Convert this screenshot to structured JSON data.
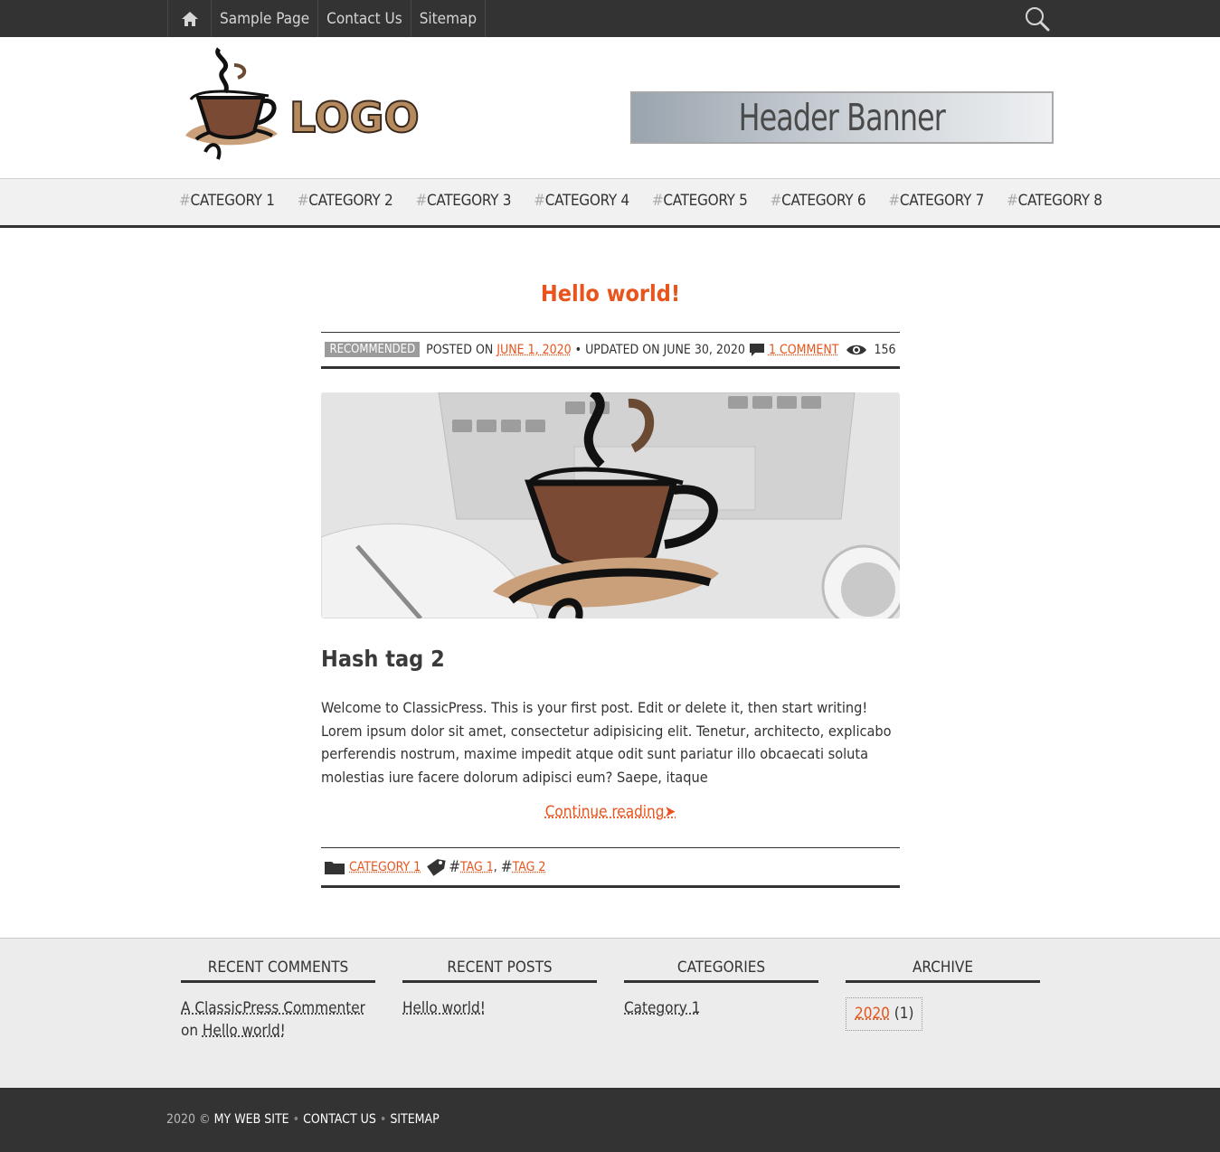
{
  "topbar": {
    "home_icon": "home-icon",
    "links": [
      "Sample Page",
      "Contact Us",
      "Sitemap"
    ],
    "search_icon": "search-icon"
  },
  "header": {
    "logo_text": "LOGO",
    "banner_text": "Header Banner"
  },
  "categories": [
    "CATEGORY 1",
    "CATEGORY 2",
    "CATEGORY 3",
    "CATEGORY 4",
    "CATEGORY 5",
    "CATEGORY 6",
    "CATEGORY 7",
    "CATEGORY 8"
  ],
  "post": {
    "title": "Hello world!",
    "badge": "RECOMMENDED",
    "posted_on_label": "POSTED ON",
    "posted_date": "JUNE 1, 2020",
    "updated_text": "• UPDATED ON JUNE 30, 2020",
    "comments_link": "1 COMMENT",
    "views": "156",
    "subtitle": "Hash tag 2",
    "excerpt": "Welcome to ClassicPress. This is your first post. Edit or delete it, then start writing! Lorem ipsum dolor sit amet, consectetur adipisicing elit. Tenetur, architecto, explicabo perferendis nostrum, maxime impedit atque odit sunt pariatur illo obcaecati soluta molestias iure facere dolorum adipisci eum? Saepe, itaque",
    "continue_label": "Continue reading",
    "category_link": "CATEGORY 1",
    "tags": [
      "TAG 1",
      "TAG 2"
    ]
  },
  "widgets": {
    "recent_comments": {
      "title": "RECENT COMMENTS",
      "author": "A ClassicPress Commenter",
      "on": "on",
      "post_link": "Hello world!"
    },
    "recent_posts": {
      "title": "RECENT POSTS",
      "post_link": "Hello world!"
    },
    "categories": {
      "title": "CATEGORIES",
      "link": "Category 1"
    },
    "archive": {
      "title": "ARCHIVE",
      "year": "2020",
      "count": "(1)"
    }
  },
  "footer": {
    "copyright": "2020 ©",
    "site_link": "MY WEB SITE",
    "contact_link": "CONTACT US",
    "sitemap_link": "SITEMAP"
  },
  "colors": {
    "accent": "#e8541c",
    "dark": "#333333",
    "nav_bg": "#f1f1f1",
    "widget_bg": "#ececec"
  }
}
